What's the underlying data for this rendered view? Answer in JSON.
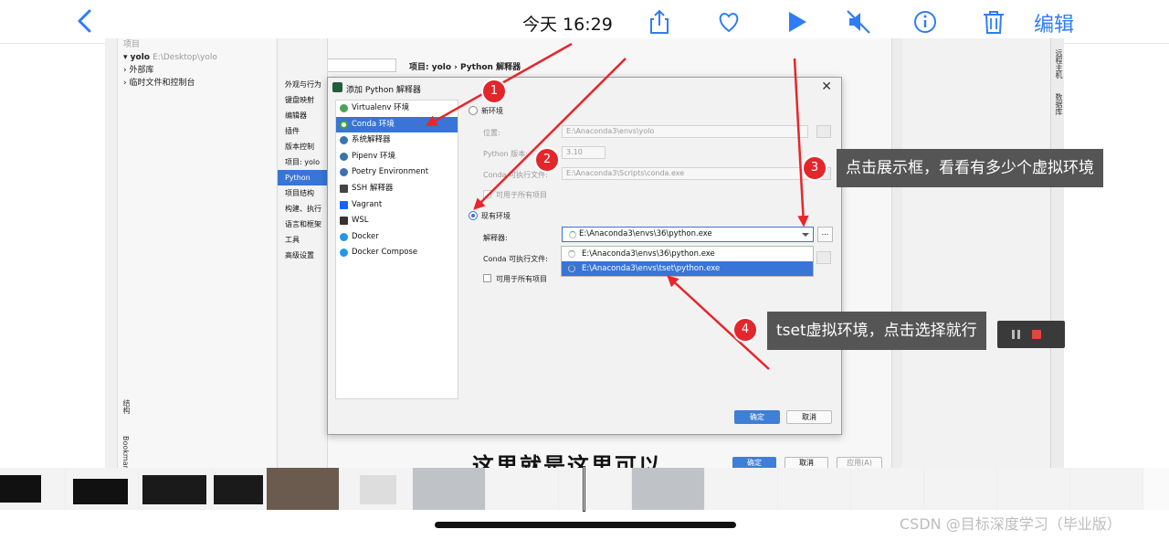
{
  "top_bar": {
    "title": "今天  16:29",
    "edit_label": "编辑",
    "icons": [
      "chevron-left-icon",
      "share-icon",
      "heart-icon",
      "play-icon",
      "mute-icon",
      "info-icon",
      "trash-icon"
    ],
    "accent_color": "#2f7cf6"
  },
  "ide": {
    "tree": [
      {
        "label": "项目",
        "muted": false
      },
      {
        "label": "yolo",
        "path": "E:\\Desktop\\yolo"
      },
      {
        "label": "外部库"
      },
      {
        "label": "临时文件和控制台"
      }
    ],
    "settings_nav": [
      {
        "label": "外观与行为"
      },
      {
        "label": "键盘映射"
      },
      {
        "label": "编辑器"
      },
      {
        "label": "插件"
      },
      {
        "label": "版本控制"
      },
      {
        "label": "项目: yolo"
      },
      {
        "label": "Python",
        "selected": true
      },
      {
        "label": "项目结构"
      },
      {
        "label": "构建、执行"
      },
      {
        "label": "语言和框架"
      },
      {
        "label": "工具"
      },
      {
        "label": "高级设置"
      }
    ],
    "breadcrumb": "项目: yolo  ›  Python 解释器",
    "bookmarks_label": "Bookmarks",
    "structure_label": "结构",
    "right_labels": [
      "远程主机",
      "数据库"
    ],
    "bottom_buttons": [
      "确定",
      "取消",
      "应用(A)"
    ],
    "caption_partial": "这里就是这里可以"
  },
  "dialog": {
    "title": "添加 Python 解释器",
    "types": [
      {
        "label": "Virtualenv 环境",
        "icon": "virtualenv-icon",
        "color": "#4aa35a"
      },
      {
        "label": "Conda 环境",
        "icon": "conda-icon",
        "color": "#44a833",
        "selected": true
      },
      {
        "label": "系统解释器",
        "icon": "python-icon",
        "color": "#3776ab"
      },
      {
        "label": "Pipenv 环境",
        "icon": "python-icon",
        "color": "#3776ab"
      },
      {
        "label": "Poetry Environment",
        "icon": "poetry-icon",
        "color": "#3b6fb6"
      },
      {
        "label": "SSH 解释器",
        "icon": "ssh-icon",
        "color": "#444"
      },
      {
        "label": "Vagrant",
        "icon": "vagrant-icon",
        "color": "#1563ff"
      },
      {
        "label": "WSL",
        "icon": "wsl-icon",
        "color": "#333"
      },
      {
        "label": "Docker",
        "icon": "docker-icon",
        "color": "#2496ed"
      },
      {
        "label": "Docker Compose",
        "icon": "docker-icon",
        "color": "#2496ed"
      }
    ],
    "new_env_label": "新环境",
    "location_label": "位置:",
    "location_value": "E:\\Anaconda3\\envs\\yolo",
    "python_version_label": "Python 版本:",
    "python_version_value": "3.10",
    "conda_exec_label": "Conda 可执行文件:",
    "conda_exec_value": "E:\\Anaconda3\\Scripts\\conda.exe",
    "available_all_projects": "可用于所有项目",
    "existing_env_label": "现有环境",
    "interpreter_label": "解释器:",
    "interpreter_value": "E:\\Anaconda3\\envs\\36\\python.exe",
    "conda_exec_label_2": "Conda 可执行文件:",
    "dropdown_options": [
      {
        "label": "E:\\Anaconda3\\envs\\36\\python.exe"
      },
      {
        "label": "E:\\Anaconda3\\envs\\tset\\python.exe",
        "selected": true
      }
    ],
    "available_all_projects_2": "可用于所有项目",
    "ok_label": "确定",
    "cancel_label": "取消",
    "more_label": "..."
  },
  "annotations": {
    "badges": [
      "1",
      "2",
      "3",
      "4"
    ],
    "tip3": "点击展示框，看看有多少个虚拟环境",
    "tip4": "tset虚拟环境，点击选择就行",
    "arrow_color": "#e8262b"
  },
  "watermark": "CSDN @目标深度学习（毕业版）"
}
